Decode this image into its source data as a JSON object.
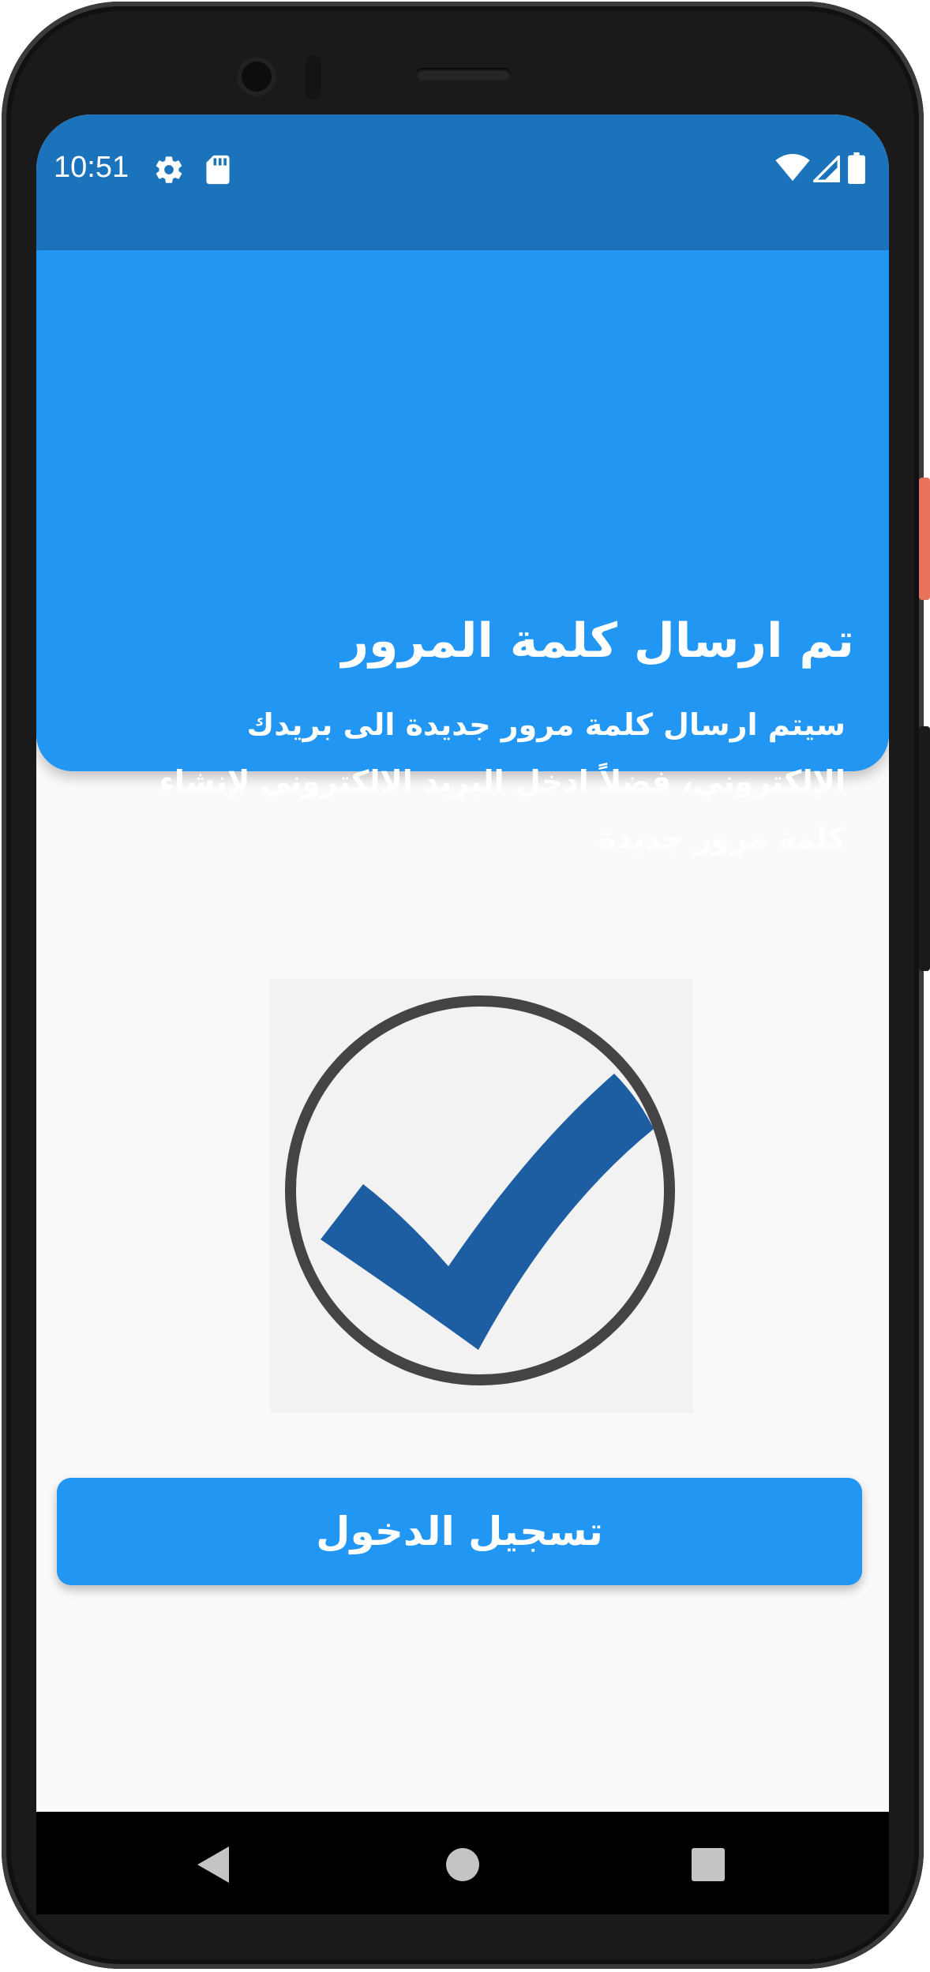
{
  "status_bar": {
    "time": "10:51",
    "left_icons": [
      "gear-icon",
      "sd-card-icon"
    ],
    "right_icons": [
      "wifi-icon",
      "signal-icon",
      "battery-icon"
    ],
    "color": "#1b73bc"
  },
  "header": {
    "title": "تم ارسال كلمة المرور",
    "description": "سيتم ارسال كلمة مرور جديدة الى بريدك الإلكتروني، فضلاً ادخل البريد الالكتروني لإنشاء كلمة مرور جديدة",
    "color": "#2196f3"
  },
  "success_image": {
    "icon": "check-circle-icon",
    "circle_color": "#444444",
    "check_color": "#1c5ea1"
  },
  "login_button": {
    "label": "تسجيل الدخول",
    "color": "#2196f3"
  },
  "nav_bar": {
    "icons": [
      "back-icon",
      "home-icon",
      "recents-icon"
    ]
  }
}
